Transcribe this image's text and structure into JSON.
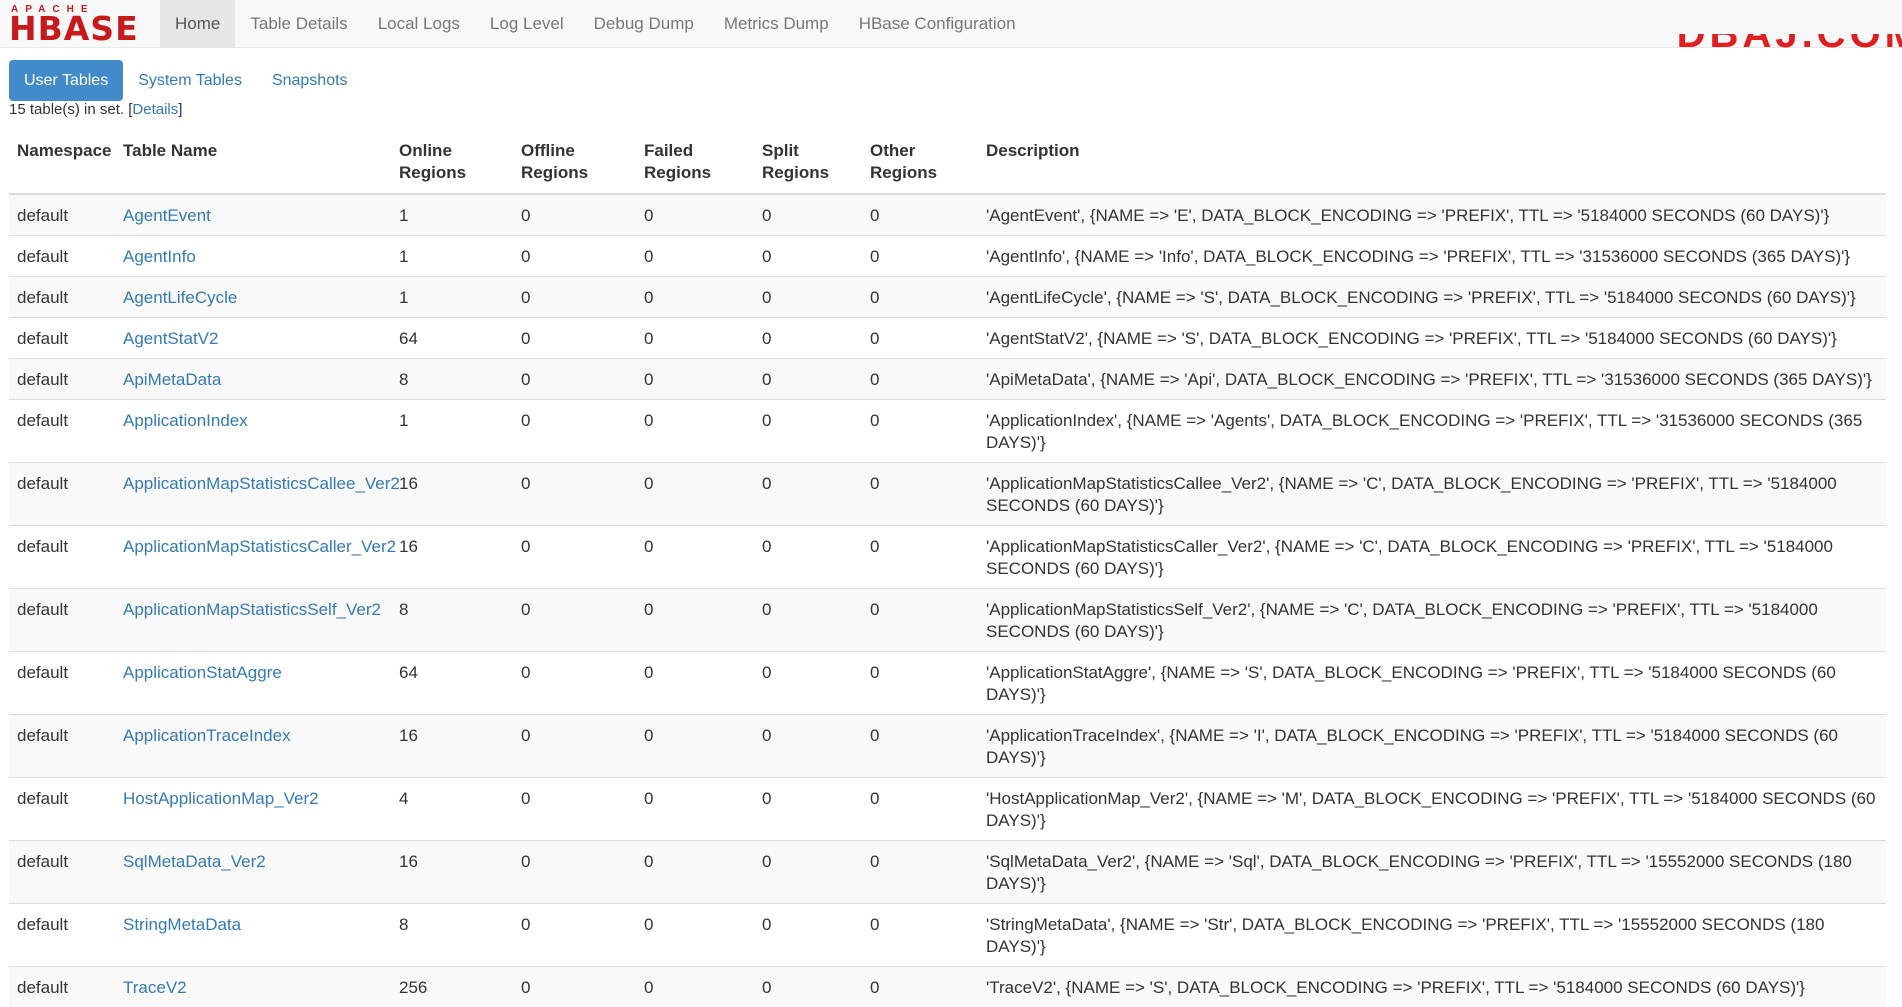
{
  "brand": {
    "apache": "APACHE",
    "hbase": "HBASE"
  },
  "nav": {
    "items": [
      {
        "label": "Home",
        "active": true
      },
      {
        "label": "Table Details"
      },
      {
        "label": "Local Logs"
      },
      {
        "label": "Log Level"
      },
      {
        "label": "Debug Dump"
      },
      {
        "label": "Metrics Dump"
      },
      {
        "label": "HBase Configuration"
      }
    ]
  },
  "corner_mark": "DBAJ.COM",
  "tabs": [
    {
      "label": "User Tables",
      "active": true
    },
    {
      "label": "System Tables"
    },
    {
      "label": "Snapshots"
    }
  ],
  "summary": {
    "prefix": "15 table(s) in set. [",
    "link": "Details",
    "suffix": "]"
  },
  "table": {
    "headers": [
      "Namespace",
      "Table Name",
      "Online Regions",
      "Offline Regions",
      "Failed Regions",
      "Split Regions",
      "Other Regions",
      "Description"
    ],
    "rows": [
      [
        "default",
        "AgentEvent",
        "1",
        "0",
        "0",
        "0",
        "0",
        "'AgentEvent', {NAME => 'E', DATA_BLOCK_ENCODING => 'PREFIX', TTL => '5184000 SECONDS (60 DAYS)'}"
      ],
      [
        "default",
        "AgentInfo",
        "1",
        "0",
        "0",
        "0",
        "0",
        "'AgentInfo', {NAME => 'Info', DATA_BLOCK_ENCODING => 'PREFIX', TTL => '31536000 SECONDS (365 DAYS)'}"
      ],
      [
        "default",
        "AgentLifeCycle",
        "1",
        "0",
        "0",
        "0",
        "0",
        "'AgentLifeCycle', {NAME => 'S', DATA_BLOCK_ENCODING => 'PREFIX', TTL => '5184000 SECONDS (60 DAYS)'}"
      ],
      [
        "default",
        "AgentStatV2",
        "64",
        "0",
        "0",
        "0",
        "0",
        "'AgentStatV2', {NAME => 'S', DATA_BLOCK_ENCODING => 'PREFIX', TTL => '5184000 SECONDS (60 DAYS)'}"
      ],
      [
        "default",
        "ApiMetaData",
        "8",
        "0",
        "0",
        "0",
        "0",
        "'ApiMetaData', {NAME => 'Api', DATA_BLOCK_ENCODING => 'PREFIX', TTL => '31536000 SECONDS (365 DAYS)'}"
      ],
      [
        "default",
        "ApplicationIndex",
        "1",
        "0",
        "0",
        "0",
        "0",
        "'ApplicationIndex', {NAME => 'Agents', DATA_BLOCK_ENCODING => 'PREFIX', TTL => '31536000 SECONDS (365 DAYS)'}"
      ],
      [
        "default",
        "ApplicationMapStatisticsCallee_Ver2",
        "16",
        "0",
        "0",
        "0",
        "0",
        "'ApplicationMapStatisticsCallee_Ver2', {NAME => 'C', DATA_BLOCK_ENCODING => 'PREFIX', TTL => '5184000 SECONDS (60 DAYS)'}"
      ],
      [
        "default",
        "ApplicationMapStatisticsCaller_Ver2",
        "16",
        "0",
        "0",
        "0",
        "0",
        "'ApplicationMapStatisticsCaller_Ver2', {NAME => 'C', DATA_BLOCK_ENCODING => 'PREFIX', TTL => '5184000 SECONDS (60 DAYS)'}"
      ],
      [
        "default",
        "ApplicationMapStatisticsSelf_Ver2",
        "8",
        "0",
        "0",
        "0",
        "0",
        "'ApplicationMapStatisticsSelf_Ver2', {NAME => 'C', DATA_BLOCK_ENCODING => 'PREFIX', TTL => '5184000 SECONDS (60 DAYS)'}"
      ],
      [
        "default",
        "ApplicationStatAggre",
        "64",
        "0",
        "0",
        "0",
        "0",
        "'ApplicationStatAggre', {NAME => 'S', DATA_BLOCK_ENCODING => 'PREFIX', TTL => '5184000 SECONDS (60 DAYS)'}"
      ],
      [
        "default",
        "ApplicationTraceIndex",
        "16",
        "0",
        "0",
        "0",
        "0",
        "'ApplicationTraceIndex', {NAME => 'I', DATA_BLOCK_ENCODING => 'PREFIX', TTL => '5184000 SECONDS (60 DAYS)'}"
      ],
      [
        "default",
        "HostApplicationMap_Ver2",
        "4",
        "0",
        "0",
        "0",
        "0",
        "'HostApplicationMap_Ver2', {NAME => 'M', DATA_BLOCK_ENCODING => 'PREFIX', TTL => '5184000 SECONDS (60 DAYS)'}"
      ],
      [
        "default",
        "SqlMetaData_Ver2",
        "16",
        "0",
        "0",
        "0",
        "0",
        "'SqlMetaData_Ver2', {NAME => 'Sql', DATA_BLOCK_ENCODING => 'PREFIX', TTL => '15552000 SECONDS (180 DAYS)'}"
      ],
      [
        "default",
        "StringMetaData",
        "8",
        "0",
        "0",
        "0",
        "0",
        "'StringMetaData', {NAME => 'Str', DATA_BLOCK_ENCODING => 'PREFIX', TTL => '15552000 SECONDS (180 DAYS)'}"
      ],
      [
        "default",
        "TraceV2",
        "256",
        "0",
        "0",
        "0",
        "0",
        "'TraceV2', {NAME => 'S', DATA_BLOCK_ENCODING => 'PREFIX', TTL => '5184000 SECONDS (60 DAYS)'}"
      ]
    ]
  },
  "colors": {
    "link": "#337ab7",
    "active_tab": "#428bca",
    "brand": "#c71b1b"
  }
}
